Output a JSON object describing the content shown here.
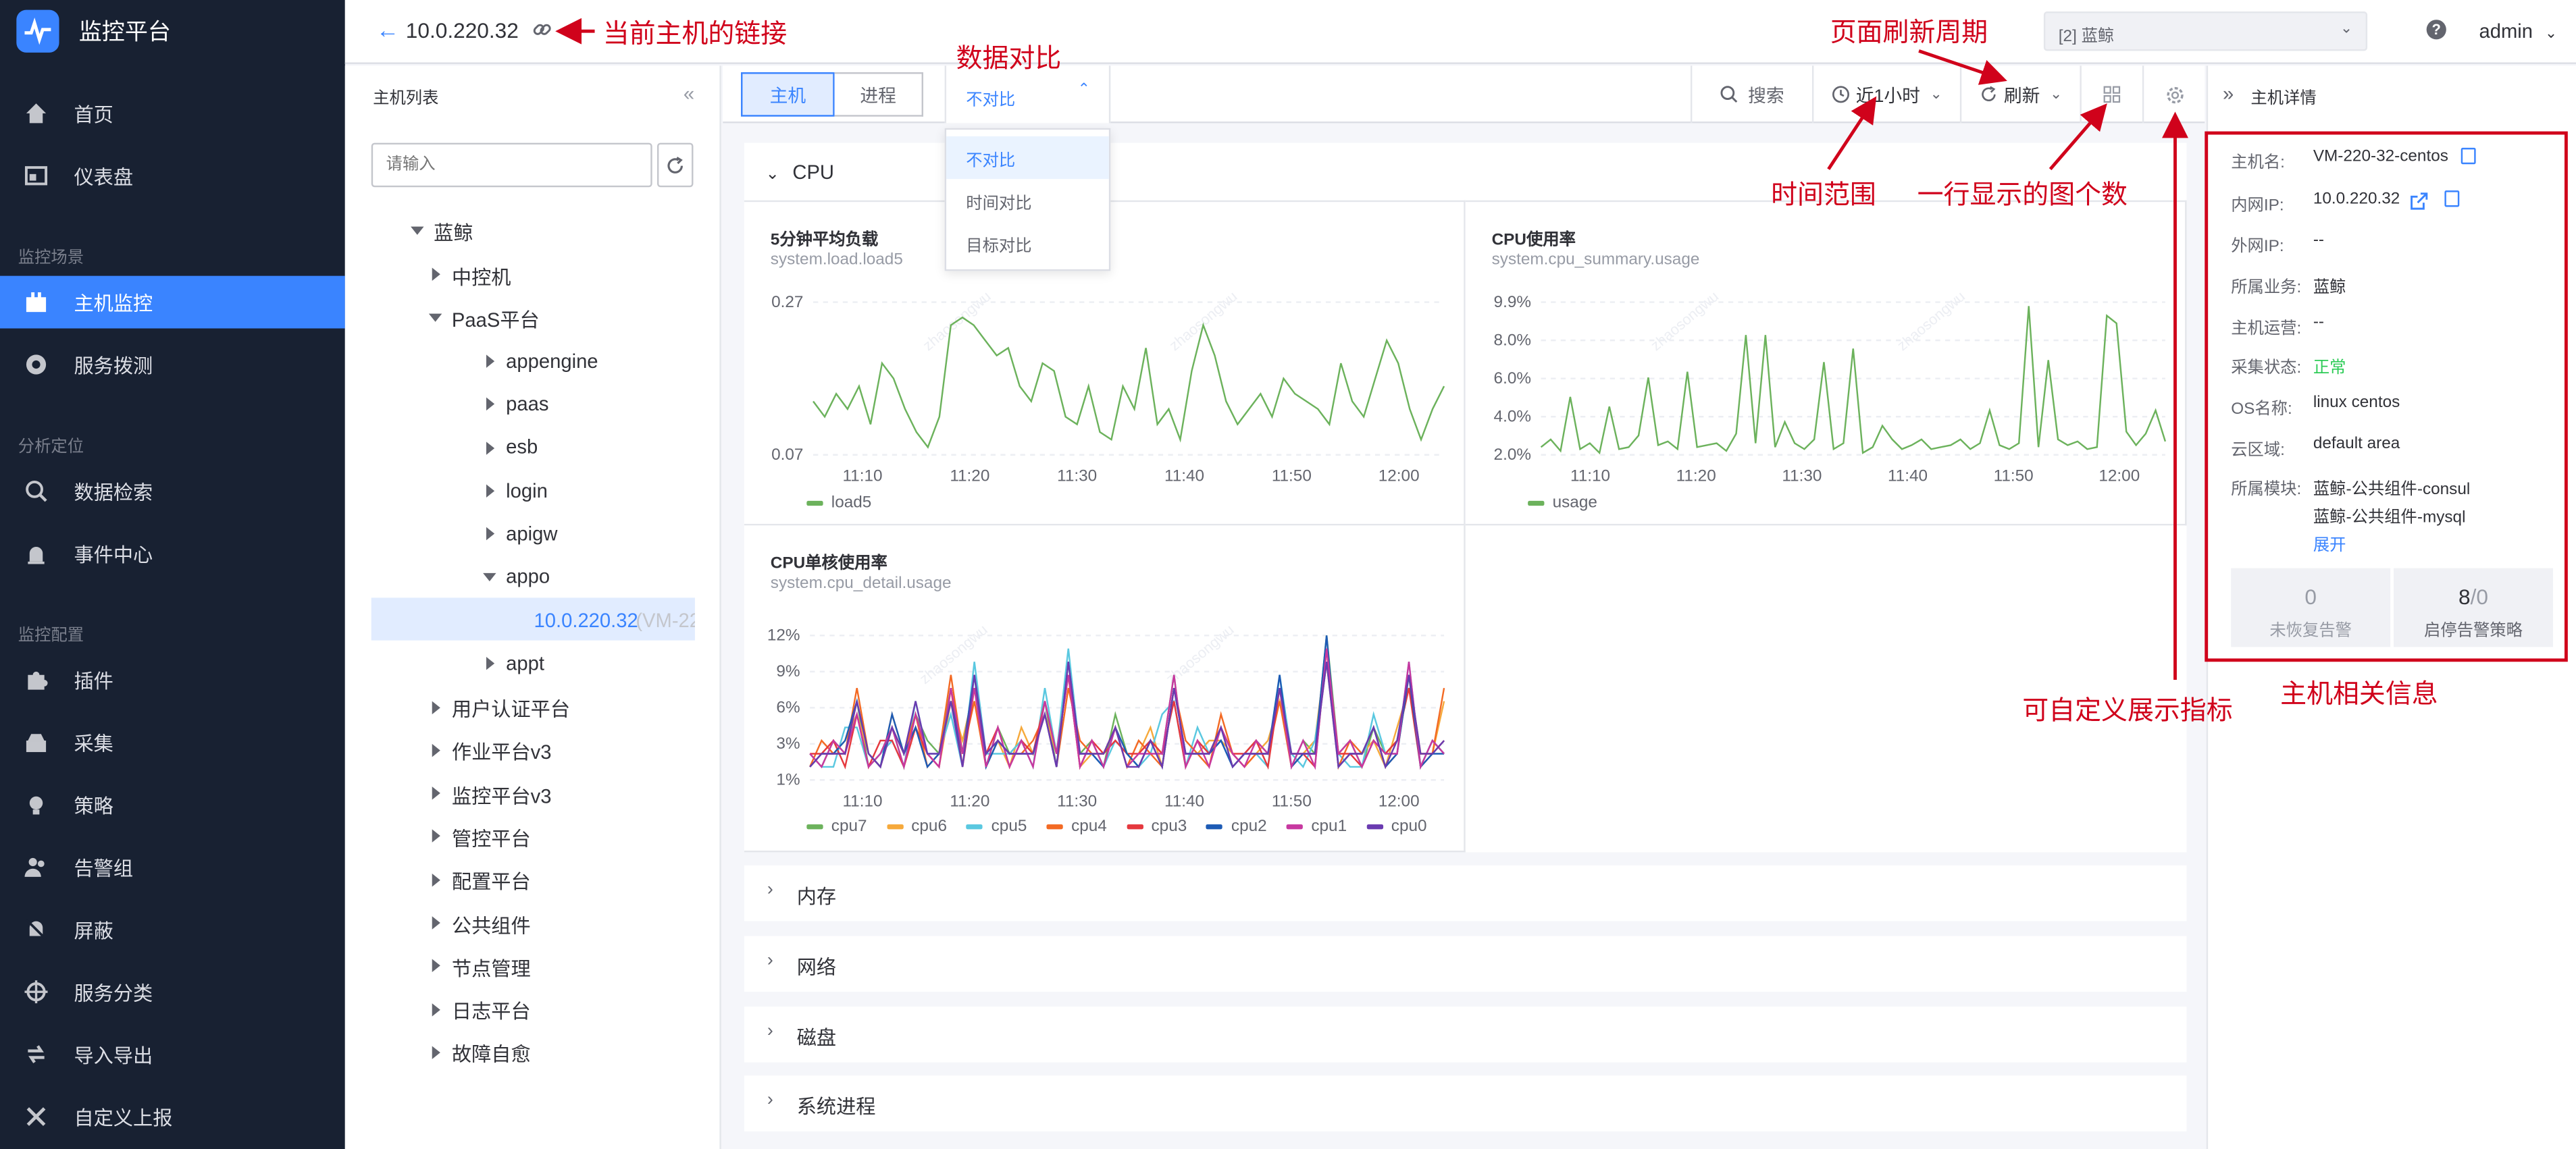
{
  "app": {
    "name": "监控平台"
  },
  "nav": {
    "home": "首页",
    "dashboard": "仪表盘",
    "sec1": "监控场景",
    "host": "主机监控",
    "probe": "服务拨测",
    "sec2": "分析定位",
    "search": "数据检索",
    "events": "事件中心",
    "sec3": "监控配置",
    "plugin": "插件",
    "collect": "采集",
    "strategy": "策略",
    "alarmgroup": "告警组",
    "mask": "屏蔽",
    "svc": "服务分类",
    "io": "导入导出",
    "custom": "自定义上报"
  },
  "header": {
    "host_ip": "10.0.220.32",
    "biz_select": "[2] 蓝鲸",
    "user": "admin",
    "help": "?"
  },
  "tree": {
    "title": "主机列表",
    "search_placeholder": "请输入",
    "nodes": {
      "root": "蓝鲸",
      "zk": "中控机",
      "paas": "PaaS平台",
      "appengine": "appengine",
      "paas2": "paas",
      "esb": "esb",
      "login": "login",
      "apigw": "apigw",
      "appo": "appo",
      "host": "10.0.220.32",
      "host_suffix": "(VM-22",
      "appt": "appt",
      "uac": "用户认证平台",
      "job": "作业平台v3",
      "mon": "监控平台v3",
      "gse": "管控平台",
      "cmdb": "配置平台",
      "pub": "公共组件",
      "node": "节点管理",
      "log": "日志平台",
      "fta": "故障自愈"
    }
  },
  "toolbar": {
    "tab_host": "主机",
    "tab_proc": "进程",
    "compare": "不对比",
    "search": "搜索",
    "time": "近1小时",
    "refresh": "刷新"
  },
  "compare_options": [
    "不对比",
    "时间对比",
    "目标对比"
  ],
  "groups": {
    "cpu": "CPU",
    "mem": "内存",
    "net": "网络",
    "disk": "磁盘",
    "proc": "系统进程"
  },
  "charts": {
    "load": {
      "title": "5分钟平均负载",
      "metric": "system.load.load5",
      "legend": "load5"
    },
    "usage": {
      "title": "CPU使用率",
      "metric": "system.cpu_summary.usage",
      "legend": "usage"
    },
    "core": {
      "title": "CPU单核使用率",
      "metric": "system.cpu_detail.usage"
    }
  },
  "chart_data": [
    {
      "type": "line",
      "title": "5分钟平均负载",
      "x": [
        "11:10",
        "11:20",
        "11:30",
        "11:40",
        "11:50",
        "12:00"
      ],
      "ylim": [
        0.07,
        0.27
      ],
      "yticks": [
        "0.27",
        "0.07"
      ],
      "series": [
        {
          "name": "load5",
          "color": "#6cb25c",
          "values": [
            0.14,
            0.12,
            0.15,
            0.13,
            0.16,
            0.11,
            0.19,
            0.17,
            0.13,
            0.1,
            0.08,
            0.12,
            0.24,
            0.25,
            0.24,
            0.22,
            0.2,
            0.21,
            0.16,
            0.14,
            0.19,
            0.18,
            0.12,
            0.11,
            0.16,
            0.1,
            0.09,
            0.16,
            0.13,
            0.21,
            0.11,
            0.13,
            0.09,
            0.18,
            0.24,
            0.2,
            0.14,
            0.11,
            0.13,
            0.15,
            0.12,
            0.17,
            0.15,
            0.14,
            0.13,
            0.11,
            0.19,
            0.14,
            0.12,
            0.17,
            0.22,
            0.19,
            0.13,
            0.09,
            0.13,
            0.16
          ]
        }
      ]
    },
    {
      "type": "line",
      "title": "CPU使用率",
      "x": [
        "11:10",
        "11:20",
        "11:30",
        "11:40",
        "11:50",
        "12:00"
      ],
      "ylim": [
        2.0,
        9.9
      ],
      "yticks": [
        "9.9%",
        "8.0%",
        "6.0%",
        "4.0%",
        "2.0%"
      ],
      "series": [
        {
          "name": "usage",
          "color": "#6cb25c",
          "values": [
            2.4,
            2.8,
            2.2,
            5.0,
            2.3,
            2.6,
            2.1,
            4.5,
            2.3,
            2.4,
            3.0,
            6.0,
            2.5,
            2.7,
            2.3,
            6.3,
            2.4,
            2.5,
            2.6,
            2.2,
            3.1,
            8.2,
            2.6,
            8.2,
            2.4,
            3.7,
            2.6,
            2.3,
            2.8,
            6.8,
            2.3,
            2.6,
            7.5,
            2.1,
            2.4,
            3.5,
            2.8,
            2.3,
            2.5,
            2.8,
            2.3,
            2.4,
            2.5,
            2.8,
            2.3,
            2.6,
            4.3,
            2.5,
            2.3,
            2.6,
            9.7,
            2.4,
            6.9,
            2.8,
            2.5,
            2.7,
            2.3,
            2.4,
            9.2,
            8.8,
            3.2,
            2.5,
            3.1,
            4.3,
            2.7
          ]
        }
      ]
    },
    {
      "type": "line",
      "title": "CPU单核使用率",
      "x": [
        "11:10",
        "11:20",
        "11:30",
        "11:40",
        "11:50",
        "12:00"
      ],
      "ylim": [
        1,
        12
      ],
      "yticks": [
        "12%",
        "9%",
        "6%",
        "3%",
        "1%"
      ],
      "series": [
        {
          "name": "cpu7",
          "color": "#6cb25c",
          "values": [
            3,
            2,
            4,
            3,
            7,
            2,
            3,
            5,
            2,
            6,
            4,
            3,
            8,
            3,
            9,
            2,
            5,
            3,
            4,
            3,
            7,
            2,
            10,
            3,
            4,
            2,
            6,
            3,
            2,
            4,
            3,
            9,
            2,
            4,
            3,
            5,
            2,
            3,
            4,
            3,
            8,
            2,
            4,
            3,
            12,
            3,
            4,
            2,
            5,
            3,
            4,
            9,
            2,
            4,
            3
          ]
        },
        {
          "name": "cpu6",
          "color": "#f6a93b",
          "values": [
            2,
            3,
            3,
            4,
            6,
            3,
            2,
            6,
            3,
            5,
            3,
            2,
            7,
            4,
            8,
            3,
            4,
            2,
            5,
            3,
            6,
            3,
            9,
            2,
            3,
            3,
            5,
            2,
            3,
            5,
            2,
            8,
            3,
            3,
            4,
            4,
            3,
            2,
            3,
            4,
            7,
            3,
            3,
            4,
            11,
            2,
            3,
            3,
            4,
            2,
            5,
            8,
            3,
            3,
            7
          ]
        },
        {
          "name": "cpu5",
          "color": "#5ac8e0",
          "values": [
            3,
            2,
            2,
            5,
            5,
            2,
            3,
            4,
            2,
            7,
            3,
            3,
            6,
            2,
            10,
            3,
            3,
            3,
            4,
            2,
            8,
            3,
            11,
            3,
            3,
            2,
            4,
            3,
            2,
            3,
            6,
            7,
            2,
            5,
            3,
            4,
            2,
            3,
            3,
            2,
            9,
            3,
            2,
            4,
            10,
            3,
            2,
            2,
            6,
            3,
            3,
            10,
            2,
            4,
            3
          ]
        },
        {
          "name": "cpu4",
          "color": "#f36a24",
          "values": [
            2,
            4,
            3,
            3,
            8,
            3,
            2,
            5,
            3,
            6,
            2,
            3,
            9,
            3,
            7,
            2,
            4,
            3,
            3,
            4,
            6,
            2,
            8,
            4,
            3,
            3,
            5,
            2,
            4,
            3,
            2,
            8,
            4,
            3,
            2,
            6,
            3,
            2,
            3,
            3,
            7,
            2,
            3,
            3,
            10,
            2,
            4,
            3,
            5,
            2,
            3,
            9,
            3,
            3,
            8
          ]
        },
        {
          "name": "cpu3",
          "color": "#e5383e",
          "values": [
            3,
            3,
            4,
            2,
            6,
            2,
            4,
            4,
            2,
            5,
            3,
            2,
            8,
            2,
            8,
            3,
            5,
            2,
            4,
            3,
            7,
            3,
            9,
            2,
            4,
            3,
            4,
            3,
            3,
            4,
            3,
            7,
            2,
            4,
            3,
            5,
            3,
            3,
            4,
            2,
            8,
            3,
            3,
            2,
            11,
            3,
            3,
            2,
            4,
            3,
            4,
            8,
            2,
            3,
            4
          ]
        },
        {
          "name": "cpu2",
          "color": "#1d5bb5",
          "values": [
            2,
            3,
            3,
            4,
            7,
            3,
            2,
            6,
            3,
            5,
            2,
            3,
            7,
            3,
            9,
            2,
            4,
            3,
            3,
            3,
            6,
            2,
            10,
            3,
            3,
            2,
            5,
            3,
            2,
            4,
            2,
            8,
            3,
            3,
            3,
            4,
            2,
            3,
            3,
            3,
            9,
            2,
            3,
            3,
            12,
            2,
            3,
            3,
            5,
            2,
            3,
            9,
            2,
            3,
            3
          ]
        },
        {
          "name": "cpu1",
          "color": "#c738a0",
          "values": [
            3,
            2,
            4,
            3,
            6,
            2,
            3,
            5,
            2,
            6,
            3,
            2,
            8,
            3,
            8,
            2,
            5,
            2,
            4,
            2,
            7,
            3,
            9,
            2,
            4,
            2,
            5,
            2,
            3,
            3,
            3,
            9,
            2,
            4,
            2,
            5,
            3,
            2,
            4,
            3,
            8,
            2,
            4,
            2,
            11,
            3,
            4,
            2,
            4,
            3,
            3,
            10,
            2,
            4,
            3
          ]
        },
        {
          "name": "cpu0",
          "color": "#6a3bb0",
          "values": [
            2,
            3,
            3,
            3,
            7,
            3,
            2,
            5,
            3,
            7,
            3,
            3,
            7,
            2,
            9,
            3,
            4,
            3,
            3,
            3,
            6,
            2,
            10,
            3,
            3,
            3,
            5,
            2,
            2,
            4,
            2,
            8,
            3,
            3,
            3,
            5,
            2,
            3,
            3,
            3,
            8,
            3,
            3,
            3,
            10,
            2,
            3,
            3,
            5,
            2,
            4,
            9,
            3,
            3,
            4
          ]
        }
      ]
    }
  ],
  "detail": {
    "title": "主机详情",
    "rows": [
      {
        "label": "主机名:",
        "value": "VM-220-32-centos"
      },
      {
        "label": "内网IP:",
        "value": "10.0.220.32"
      },
      {
        "label": "外网IP:",
        "value": "--"
      },
      {
        "label": "所属业务:",
        "value": "蓝鲸"
      },
      {
        "label": "主机运营:",
        "value": "--"
      },
      {
        "label": "采集状态:",
        "value": "正常"
      },
      {
        "label": "OS名称:",
        "value": "linux centos"
      },
      {
        "label": "云区域:",
        "value": "default area"
      },
      {
        "label": "所属模块:",
        "value": "蓝鲸-公共组件-consul"
      }
    ],
    "module2": "蓝鲸-公共组件-mysql",
    "expand": "展开",
    "stat1_num": "0",
    "stat1_label": "未恢复告警",
    "stat2_num": "8",
    "stat2_sub": "/0",
    "stat2_label": "启停告警策略",
    "status_color": "#2dcb56"
  },
  "watermark": "zhaosongwu",
  "annotations": {
    "link": "当前主机的链接",
    "compare": "数据对比",
    "refresh": "页面刷新周期",
    "time": "时间范围",
    "layout": "一行显示的图个数",
    "custom": "可自定义展示指标",
    "info": "主机相关信息"
  }
}
